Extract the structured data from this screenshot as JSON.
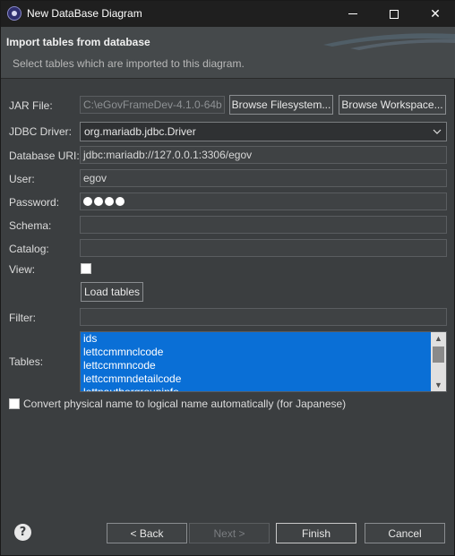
{
  "window": {
    "title": "New DataBase Diagram",
    "minimize_icon": "minimize-icon",
    "maximize_icon": "maximize-icon",
    "close_icon": "close-icon"
  },
  "banner": {
    "title": "Import tables from database",
    "description": "Select tables which are imported to this diagram."
  },
  "form": {
    "jar_file": {
      "label": "JAR File:",
      "value": "C:\\eGovFrameDev-4.1.0-64b"
    },
    "browse_filesystem": "Browse Filesystem...",
    "browse_workspace": "Browse Workspace...",
    "jdbc_driver": {
      "label": "JDBC Driver:",
      "value": "org.mariadb.jdbc.Driver"
    },
    "database_uri": {
      "label": "Database URI:",
      "value": "jdbc:mariadb://127.0.0.1:3306/egov"
    },
    "user": {
      "label": "User:",
      "value": "egov"
    },
    "password": {
      "label": "Password:",
      "masked_length": 4
    },
    "schema": {
      "label": "Schema:",
      "value": ""
    },
    "catalog": {
      "label": "Catalog:",
      "value": ""
    },
    "view": {
      "label": "View:",
      "checked": false
    },
    "load_tables": "Load tables",
    "filter": {
      "label": "Filter:",
      "value": ""
    },
    "tables": {
      "label": "Tables:",
      "items": [
        "ids",
        "lettccmmnclcode",
        "lettccmmncode",
        "lettccmmndetailcode",
        "lettnauthorgroupinfo"
      ]
    },
    "convert": {
      "label": "Convert physical name to logical name automatically (for Japanese)",
      "checked": false
    }
  },
  "footer": {
    "help_icon": "help-icon",
    "back": "< Back",
    "next": "Next >",
    "finish": "Finish",
    "cancel": "Cancel"
  },
  "colors": {
    "selection": "#0a6fd6",
    "background": "#3b3e40",
    "titlebar": "#1f1f1f"
  }
}
